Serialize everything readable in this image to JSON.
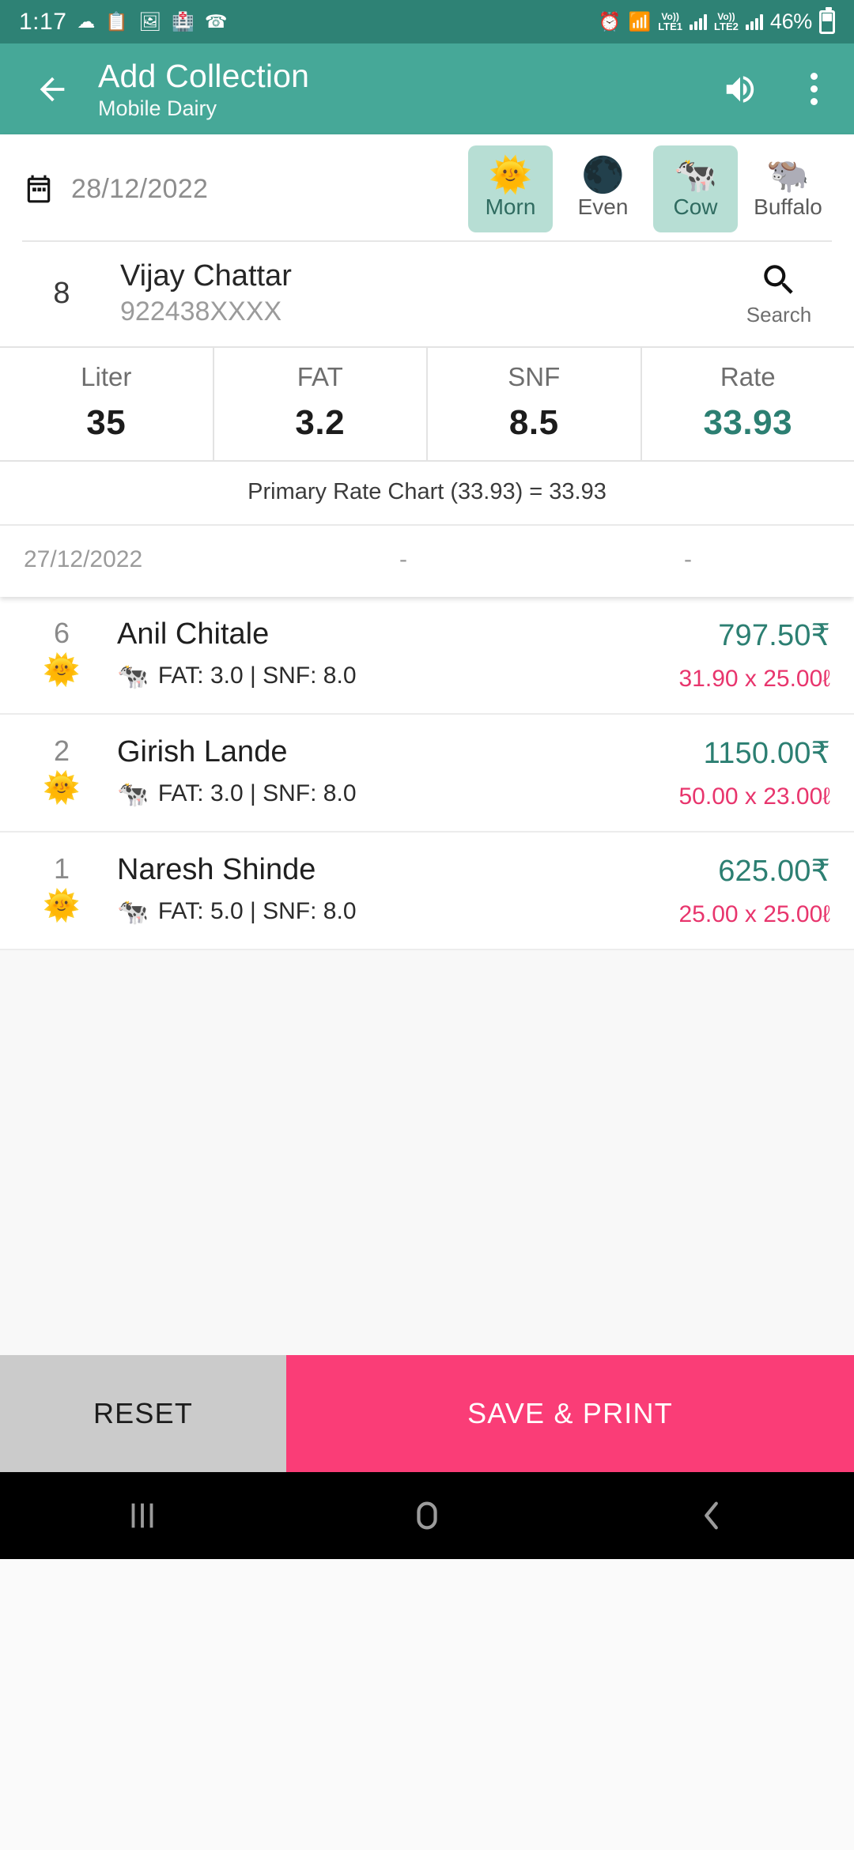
{
  "status_bar": {
    "time": "1:17",
    "left_icons": [
      "cloud-download-icon",
      "note-check-icon",
      "image-icon",
      "health-icon",
      "phone-icon"
    ],
    "alarm_icon": "alarm-icon",
    "wifi_icon": "wifi-icon",
    "sim1_volte": "Vo))",
    "sim1_label": "LTE1",
    "sim2_volte": "Vo))",
    "sim2_label": "LTE2",
    "battery_percent": "46%"
  },
  "app_bar": {
    "back_icon": "arrow-left-icon",
    "title": "Add Collection",
    "subtitle": "Mobile Dairy",
    "speaker_icon": "volume-up-icon",
    "overflow_icon": "more-vertical-icon"
  },
  "entry_card": {
    "calendar_icon": "calendar-icon",
    "date": "28/12/2022",
    "shift_chips": [
      {
        "emoji": "🌞",
        "label": "Morn",
        "icon": "sun-icon",
        "selected": true
      },
      {
        "emoji": "🌑",
        "label": "Even",
        "icon": "moon-icon",
        "selected": false
      }
    ],
    "animal_chips": [
      {
        "emoji": "🐄",
        "label": "Cow",
        "icon": "cow-icon",
        "selected": true
      },
      {
        "emoji": "🐃",
        "label": "Buffalo",
        "icon": "buffalo-icon",
        "selected": false
      }
    ],
    "farmer": {
      "code": "8",
      "name": "Vijay Chattar",
      "phone": "922438XXXX",
      "search_icon": "search-icon",
      "search_label": "Search"
    },
    "metrics": [
      {
        "label": "Liter",
        "value": "35",
        "accent": false
      },
      {
        "label": "FAT",
        "value": "3.2",
        "accent": false
      },
      {
        "label": "SNF",
        "value": "8.5",
        "accent": false
      },
      {
        "label": "Rate",
        "value": "33.93",
        "accent": true
      }
    ],
    "rate_note": "Primary Rate Chart (33.93) = 33.93",
    "previous": {
      "date": "27/12/2022",
      "value1": "-",
      "value2": "-"
    }
  },
  "collections": [
    {
      "code": "6",
      "shift_emoji": "🌞",
      "name": "Anil Chitale",
      "animal_emoji": "🐄",
      "meta": "FAT: 3.0 | SNF: 8.0",
      "amount": "797.50₹",
      "calc": "31.90 x 25.00ℓ"
    },
    {
      "code": "2",
      "shift_emoji": "🌞",
      "name": "Girish Lande",
      "animal_emoji": "🐄",
      "meta": "FAT: 3.0 | SNF: 8.0",
      "amount": "1150.00₹",
      "calc": "50.00 x 23.00ℓ"
    },
    {
      "code": "1",
      "shift_emoji": "🌞",
      "name": "Naresh Shinde",
      "animal_emoji": "🐄",
      "meta": "FAT: 5.0 | SNF: 8.0",
      "amount": "625.00₹",
      "calc": "25.00 x 25.00ℓ"
    }
  ],
  "actions": {
    "reset_label": "RESET",
    "save_label": "SAVE & PRINT"
  },
  "nav_bar": {
    "recents_icon": "recent-apps-icon",
    "home_icon": "home-icon",
    "back_icon": "back-chevron-icon"
  },
  "colors": {
    "status_bar": "#2e8275",
    "app_bar": "#46a898",
    "accent_teal": "#2c7f72",
    "chip_selected": "#b7ded4",
    "pink": "#fa3d77",
    "calc_pink": "#e8356d",
    "reset_gray": "#cbcbcb"
  }
}
